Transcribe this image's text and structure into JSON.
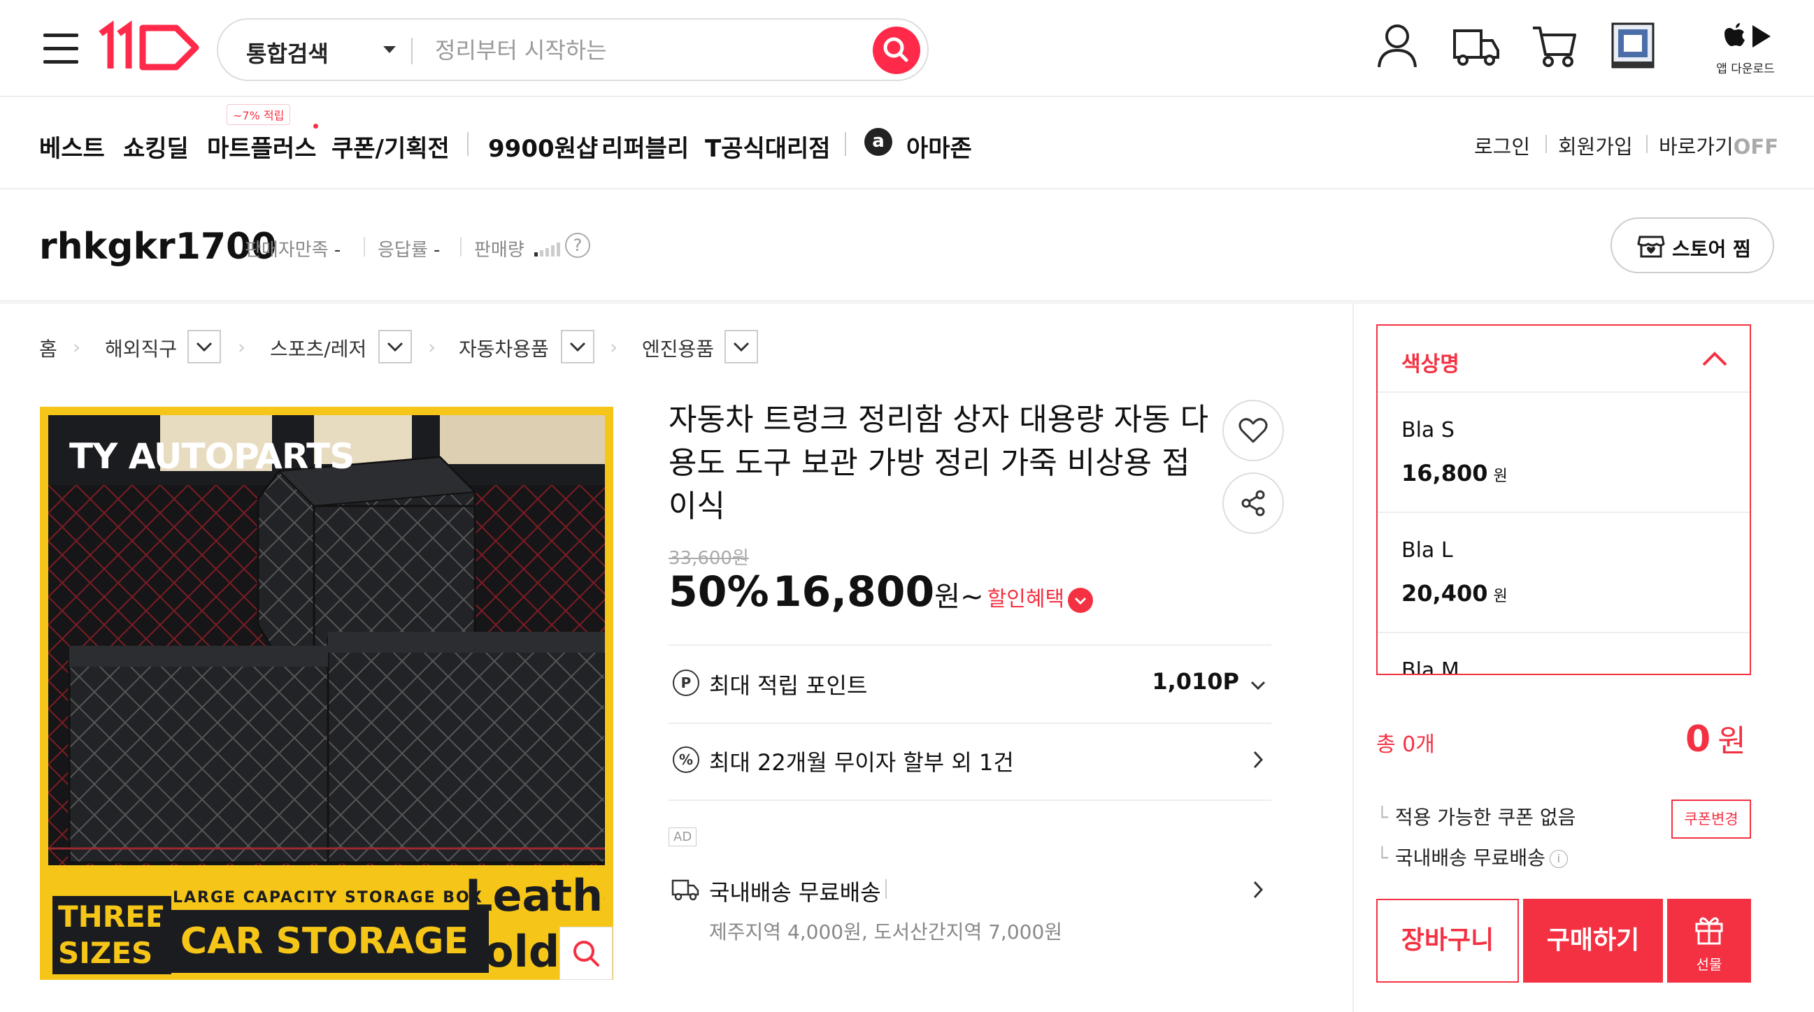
{
  "header": {
    "search_category": "통합검색",
    "search_placeholder": "정리부터 시작하는",
    "app_download_label": "앱 다운로드"
  },
  "nav": {
    "items": [
      "베스트",
      "쇼킹딜",
      "마트플러스",
      "쿠폰/기획전",
      "9900원샵",
      "리퍼블리",
      "T공식대리점",
      "아마존"
    ],
    "badge": "~7% 적립",
    "amazon_icon_letter": "a",
    "right": {
      "login": "로그인",
      "signup": "회원가입",
      "shortcut": "바로가기",
      "shortcut_state": "OFF"
    }
  },
  "seller": {
    "name": "rhkgkr1700",
    "satisfaction_label": "판매자만족",
    "satisfaction_value": "-",
    "response_label": "응답률",
    "response_value": "-",
    "sales_label": "판매량",
    "help": "?",
    "store_button": "스토어 찜"
  },
  "breadcrumb": [
    "홈",
    "해외직구",
    "스포츠/레저",
    "자동차용품",
    "엔진용품"
  ],
  "product": {
    "image_texts": {
      "brand": "TY AUTOPARTS",
      "three_sizes": "THREE SIZES",
      "large_capacity": "LARGE CAPACITY STORAGE BOX",
      "car_storage": "CAR STORAGE BOX",
      "leather": "Leather foldi"
    },
    "title": "자동차 트렁크 정리함 상자 대용량 자동 다용도 도구 보관 가방 정리 가죽 비상용 접이식",
    "original_price": "33,600원",
    "discount": "50%",
    "price": "16,800",
    "price_unit": "원~",
    "benefit_label": "할인혜택",
    "points": {
      "icon": "P",
      "label": "최대 적립 포인트",
      "value": "1,010P"
    },
    "installment": {
      "icon": "%",
      "label": "최대 22개월 무이자 할부 외 1건"
    },
    "ad_label": "AD",
    "shipping": {
      "label": "국내배송 무료배송",
      "sub": "제주지역 4,000원, 도서산간지역 7,000원"
    }
  },
  "sidebar": {
    "option_header": "색상명",
    "options": [
      {
        "name": "Bla S",
        "price": "16,800",
        "unit": "원"
      },
      {
        "name": "Bla L",
        "price": "20,400",
        "unit": "원"
      },
      {
        "name": "Bla M",
        "price": "",
        "unit": ""
      }
    ],
    "total_label": "총 0개",
    "total_price": "0",
    "total_unit": "원",
    "coupon_line": "적용 가능한 쿠폰 없음",
    "coupon_button": "쿠폰변경",
    "shipping_line": "국내배송 무료배송",
    "cart_button": "장바구니",
    "buy_button": "구매하기",
    "gift_button": "선물"
  },
  "colors": {
    "accent": "#f43142",
    "search_button": "#ff2a4a",
    "image_yellow": "#f5c518"
  }
}
